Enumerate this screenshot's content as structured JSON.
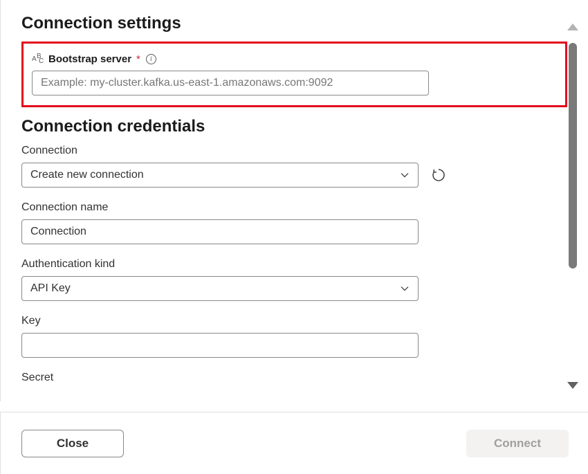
{
  "settings": {
    "heading": "Connection settings",
    "bootstrap": {
      "label": "Bootstrap server",
      "required_mark": "*",
      "placeholder": "Example: my-cluster.kafka.us-east-1.amazonaws.com:9092",
      "value": ""
    }
  },
  "credentials": {
    "heading": "Connection credentials",
    "connection": {
      "label": "Connection",
      "value": "Create new connection"
    },
    "connection_name": {
      "label": "Connection name",
      "value": "Connection"
    },
    "auth_kind": {
      "label": "Authentication kind",
      "value": "API Key"
    },
    "key": {
      "label": "Key",
      "value": ""
    },
    "secret": {
      "label": "Secret",
      "value": ""
    }
  },
  "footer": {
    "close": "Close",
    "connect": "Connect"
  },
  "icons": {
    "info": "i"
  }
}
